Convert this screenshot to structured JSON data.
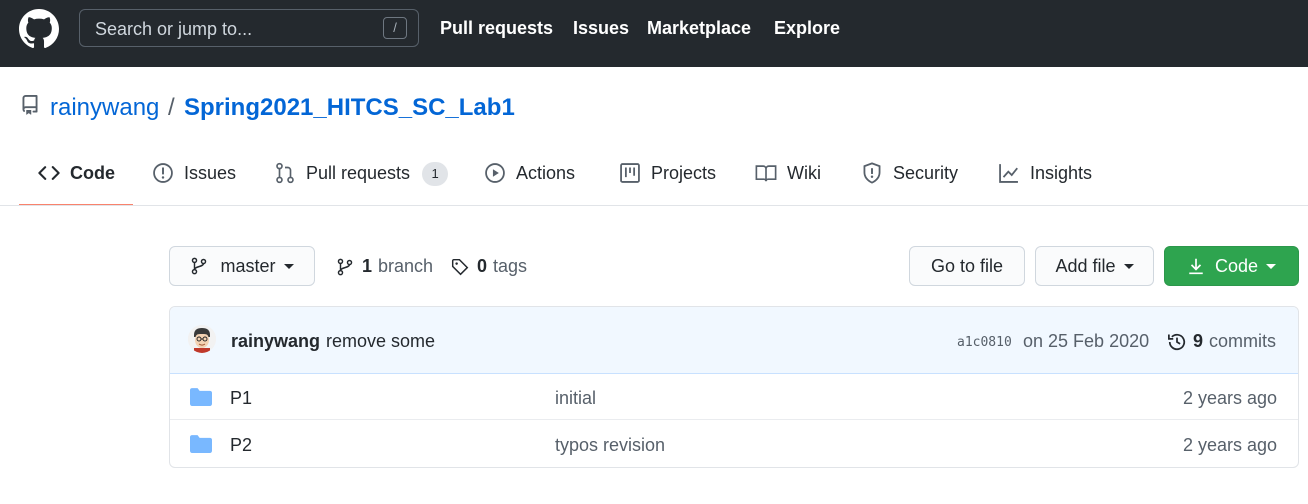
{
  "header": {
    "search_placeholder": "Search or jump to...",
    "slash_key": "/",
    "nav": [
      "Pull requests",
      "Issues",
      "Marketplace",
      "Explore"
    ]
  },
  "repo": {
    "owner": "rainywang",
    "separator": "/",
    "name": "Spring2021_HITCS_SC_Lab1"
  },
  "tabs": [
    {
      "label": "Code",
      "icon": "code-icon",
      "active": true
    },
    {
      "label": "Issues",
      "icon": "issue-icon"
    },
    {
      "label": "Pull requests",
      "icon": "pull-request-icon",
      "count": "1"
    },
    {
      "label": "Actions",
      "icon": "play-icon"
    },
    {
      "label": "Projects",
      "icon": "project-icon"
    },
    {
      "label": "Wiki",
      "icon": "book-icon"
    },
    {
      "label": "Security",
      "icon": "shield-icon"
    },
    {
      "label": "Insights",
      "icon": "graph-icon"
    }
  ],
  "toolbar": {
    "branch_select": "master",
    "branch_count": "1",
    "branch_label": "branch",
    "tag_count": "0",
    "tag_label": "tags",
    "go_to_file": "Go to file",
    "add_file": "Add file",
    "code_button": "Code"
  },
  "latest_commit": {
    "author": "rainywang",
    "message": "remove some",
    "sha": "a1c0810",
    "date": "on 25 Feb 2020",
    "commit_count": "9",
    "commit_label": "commits"
  },
  "files": [
    {
      "name": "P1",
      "message": "initial",
      "age": "2 years ago",
      "icon": "folder-icon"
    },
    {
      "name": "P2",
      "message": "typos revision",
      "age": "2 years ago",
      "icon": "folder-icon"
    }
  ],
  "colors": {
    "header_bg": "#24292e",
    "link_blue": "#0366d6",
    "active_tab_underline": "#f9826c",
    "code_button_green": "#2ea44f",
    "folder_blue": "#79b8ff"
  }
}
